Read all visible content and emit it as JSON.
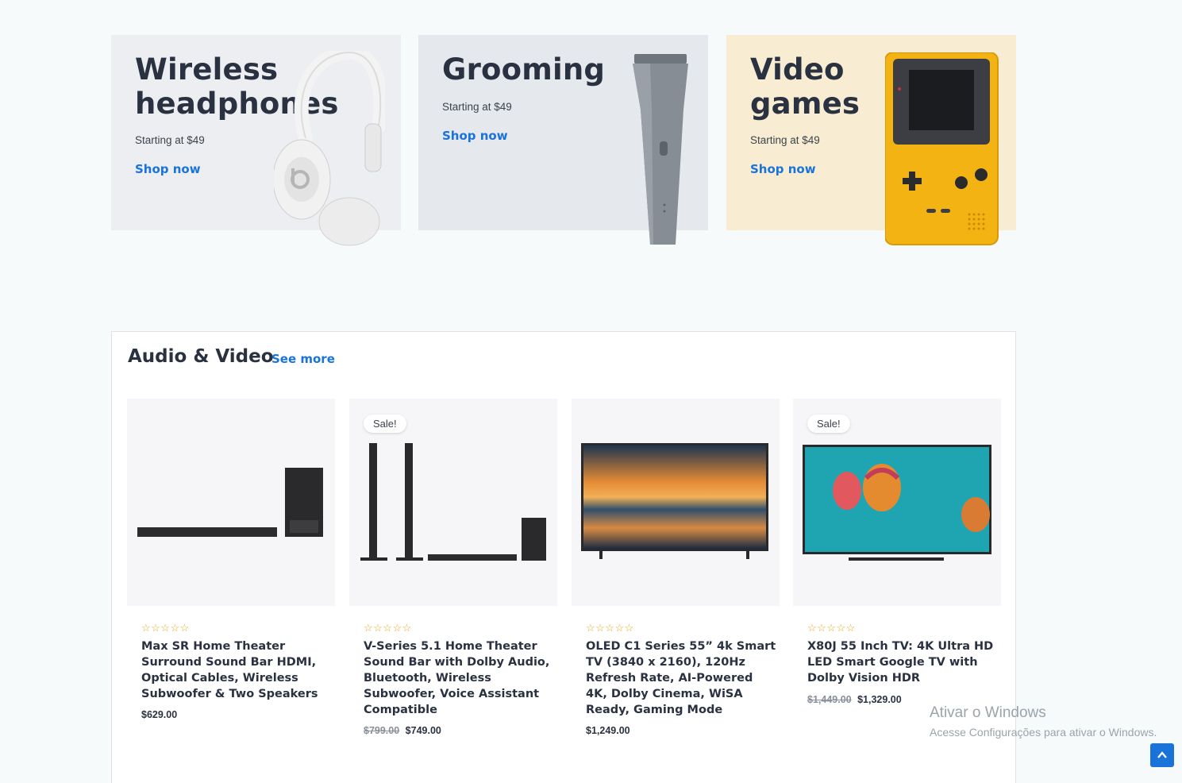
{
  "promos": [
    {
      "title": "Wireless headphones",
      "subtitle": "Starting at $49",
      "link": "Shop now",
      "icon": "headphones-image"
    },
    {
      "title": "Grooming",
      "subtitle": "Starting at $49",
      "link": "Shop now",
      "icon": "hair-clipper-image"
    },
    {
      "title": "Video games",
      "subtitle": "Starting at $49",
      "link": "Shop now",
      "icon": "game-boy-image"
    }
  ],
  "section": {
    "title": "Audio & Video",
    "see_more": "See more"
  },
  "products": [
    {
      "name": "Max SR Home Theater Surround Sound Bar HDMI, Optical Cables, Wireless Subwoofer & Two Speakers",
      "price": "$629.00",
      "old_price": "",
      "sale": "",
      "rating": 0
    },
    {
      "name": "V-Series 5.1 Home Theater Sound Bar with Dolby Audio, Bluetooth, Wireless Subwoofer, Voice Assistant Compatible",
      "price": "$749.00",
      "old_price": "$799.00",
      "sale": "Sale!",
      "rating": 0
    },
    {
      "name": "OLED C1 Series 55” 4k Smart TV (3840 x 2160), 120Hz Refresh Rate, AI-Powered 4K, Dolby Cinema, WiSA Ready, Gaming Mode",
      "price": "$1,249.00",
      "old_price": "",
      "sale": "",
      "rating": 0
    },
    {
      "name": "X80J 55 Inch TV: 4K Ultra HD LED Smart Google TV with Dolby Vision HDR",
      "price": "$1,329.00",
      "old_price": "$1,449.00",
      "sale": "Sale!",
      "rating": 0
    }
  ],
  "stars": "☆☆☆☆☆",
  "watermark": {
    "line1": "Ativar o Windows",
    "line2": "Acesse Configurações para ativar o Windows."
  },
  "colors": {
    "accent": "#1a73d9",
    "star": "#e3a81e",
    "promo1": "#eceef1",
    "promo2": "#e5e8ec",
    "promo3": "#f8edd2"
  }
}
